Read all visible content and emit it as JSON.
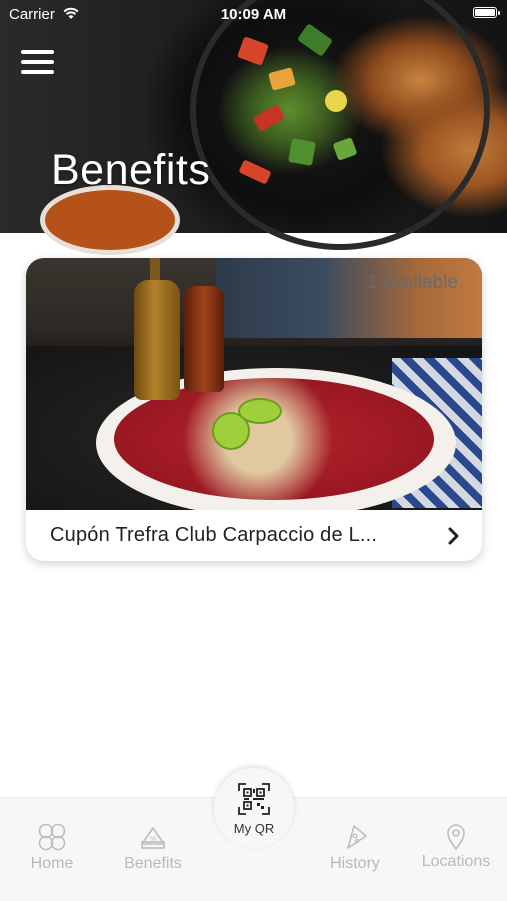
{
  "status_bar": {
    "carrier": "Carrier",
    "time": "10:09 AM"
  },
  "header": {
    "title": "Benefits",
    "menu_icon": "hamburger-menu-icon"
  },
  "benefits": [
    {
      "title": "Cupón Trefra Club Carpaccio de L...",
      "availability": "1 available",
      "image": "carpaccio-photo"
    }
  ],
  "tab_bar": {
    "tabs": [
      {
        "label": "Home",
        "icon": "home-icon"
      },
      {
        "label": "Benefits",
        "icon": "benefits-icon"
      },
      {
        "label": "My QR",
        "icon": "qr-code-icon"
      },
      {
        "label": "History",
        "icon": "history-icon"
      },
      {
        "label": "Locations",
        "icon": "location-pin-icon"
      }
    ],
    "inactive_color": "#b9b9b9",
    "active_label_color": "#333333"
  }
}
